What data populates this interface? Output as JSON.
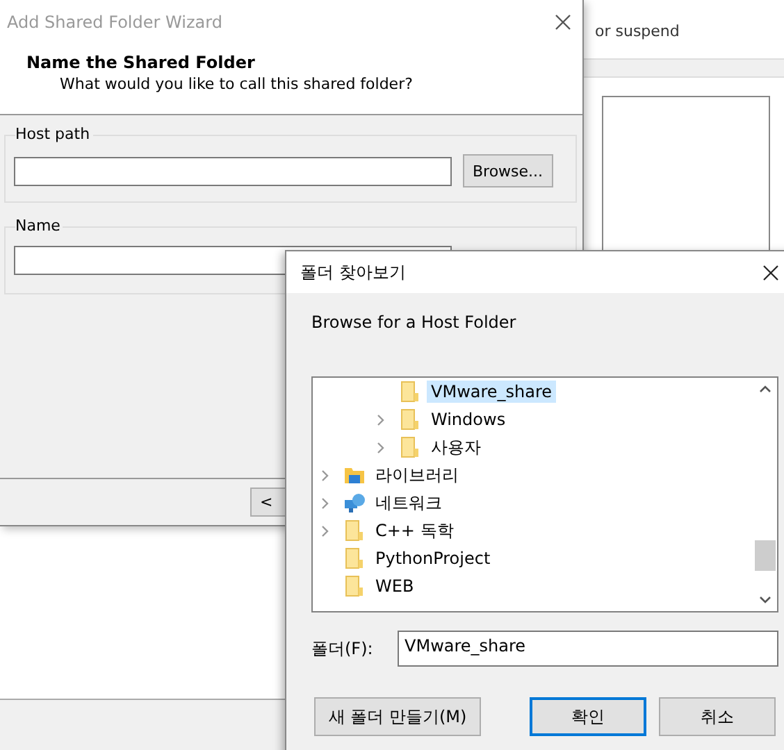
{
  "background_window": {
    "fragment_text": "or suspend"
  },
  "wizard": {
    "title": "Add Shared Folder Wizard",
    "heading": "Name the Shared Folder",
    "subheading": "What would you like to call this shared folder?",
    "host_path": {
      "label": "Host path",
      "button": "Browse..."
    },
    "name": {
      "label": "Name"
    },
    "footer_button": "<"
  },
  "folder_dialog": {
    "title": "폴더 찾아보기",
    "prompt": "Browse for a Host Folder",
    "tree": [
      {
        "children": [
          {
            "children": [
              {
                "label": "VMware_share",
                "kind": "folder",
                "expandable": false,
                "selected": true
              },
              {
                "label": "Windows",
                "kind": "folder",
                "expandable": true,
                "selected": false
              },
              {
                "label": "사용자",
                "kind": "folder",
                "expandable": true,
                "selected": false
              }
            ]
          }
        ]
      },
      {
        "label": "라이브러리",
        "kind": "library",
        "expandable": true,
        "selected": false
      },
      {
        "label": "네트워크",
        "kind": "network",
        "expandable": true,
        "selected": false
      },
      {
        "label": "C++ 독학",
        "kind": "folder",
        "expandable": true,
        "selected": false
      },
      {
        "label": "PythonProject",
        "kind": "folder",
        "expandable": false,
        "selected": false
      },
      {
        "label": "WEB",
        "kind": "folder",
        "expandable": false,
        "selected": false
      }
    ],
    "folder_label": "폴더(F):",
    "folder_value": "VMware_share",
    "buttons": [
      {
        "label": "새 폴더 만들기(M)",
        "default": false
      },
      {
        "label": "확인",
        "default": true
      },
      {
        "label": "취소",
        "default": false
      }
    ]
  }
}
